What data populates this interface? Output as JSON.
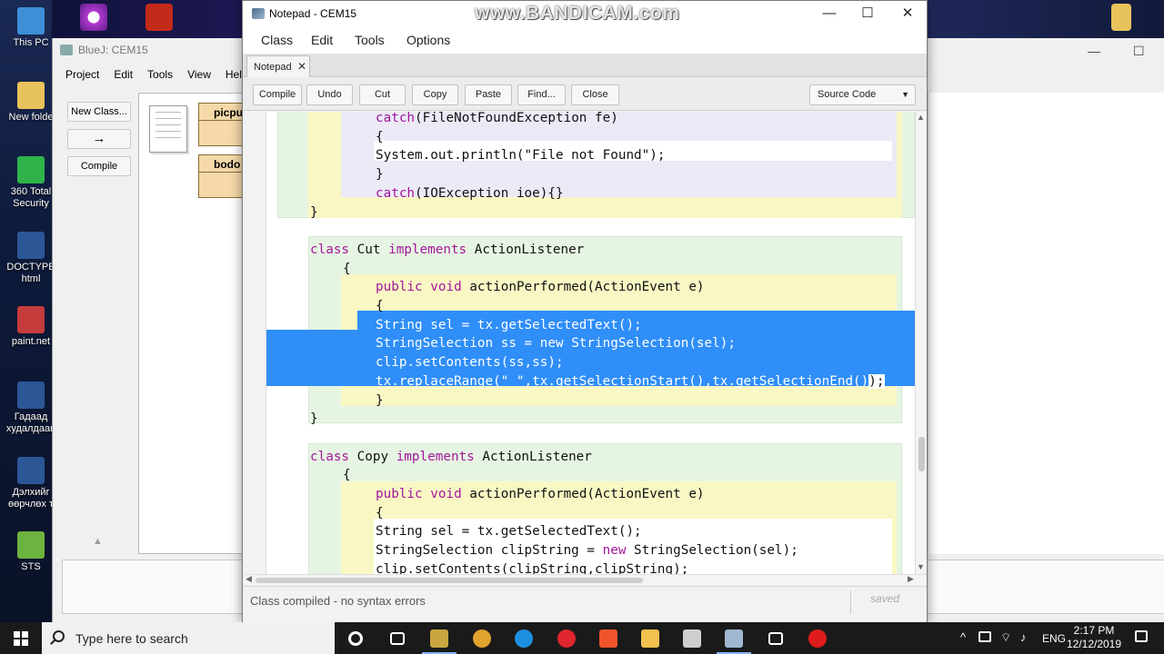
{
  "watermark": "www.BANDICAM.com",
  "desktop": {
    "icons": [
      {
        "label": "This PC",
        "icon": "computer-icon",
        "color": "#3d8fd8"
      },
      {
        "label": "New folde",
        "icon": "folder-icon",
        "color": "#e8c25a"
      },
      {
        "label": "360 Total Security",
        "icon": "shield-plus-icon",
        "color": "#2fb34a"
      },
      {
        "label": "DOCTYPE html",
        "icon": "word-doc-icon",
        "color": "#2b5797"
      },
      {
        "label": "paint.net",
        "icon": "paintnet-icon",
        "color": "#c43c3c"
      },
      {
        "label": "Гадаад худалдаан",
        "icon": "word-doc-icon",
        "color": "#2b5797"
      },
      {
        "label": "Дэлхийг өөрчлөх т",
        "icon": "word-doc-icon",
        "color": "#2b5797"
      },
      {
        "label": "STS",
        "icon": "sts-leaf-icon",
        "color": "#6db33f"
      }
    ]
  },
  "bluej": {
    "title": "BlueJ:  CEM15",
    "menu": [
      "Project",
      "Edit",
      "Tools",
      "View",
      "Help"
    ],
    "buttons": {
      "new_class": "New Class...",
      "arrow": "→",
      "compile": "Compile"
    },
    "classes": [
      {
        "name": "picpu"
      },
      {
        "name": "bodo"
      }
    ],
    "triangle": "▲"
  },
  "notepad": {
    "title": "Notepad - CEM15",
    "window_controls": {
      "minimize": "—",
      "maximize": "☐",
      "close": "✕"
    },
    "menu": [
      "Class",
      "Edit",
      "Tools",
      "Options"
    ],
    "tab": {
      "label": "Notepad",
      "close": "✕"
    },
    "toolbar": {
      "buttons": [
        "Compile",
        "Undo",
        "Cut",
        "Copy",
        "Paste",
        "Find...",
        "Close"
      ],
      "view_select": "Source Code",
      "view_caret": "▼"
    },
    "code_lines": [
      {
        "indent": 3,
        "parts": [
          [
            "kw",
            "catch"
          ],
          [
            "",
            "(FileNotFoundException fe)"
          ]
        ]
      },
      {
        "indent": 4,
        "parts": [
          [
            "",
            "{"
          ]
        ]
      },
      {
        "indent": 4,
        "parts": [
          [
            "",
            "System.out.println(\"File not Found\");"
          ]
        ]
      },
      {
        "indent": 3,
        "parts": [
          [
            "",
            "}"
          ]
        ]
      },
      {
        "indent": 3,
        "parts": [
          [
            "kw",
            "catch"
          ],
          [
            "",
            "(IOException ioe){}"
          ]
        ]
      },
      {
        "indent": 1,
        "parts": [
          [
            "",
            "}"
          ]
        ]
      },
      {
        "indent": 0,
        "parts": [
          [
            "",
            ""
          ]
        ]
      },
      {
        "indent": 1,
        "parts": [
          [
            "kw",
            "class"
          ],
          [
            "",
            " Cut "
          ],
          [
            "kw",
            "implements"
          ],
          [
            "",
            " ActionListener"
          ]
        ]
      },
      {
        "indent": 2,
        "parts": [
          [
            "",
            "{"
          ]
        ]
      },
      {
        "indent": 3,
        "parts": [
          [
            "kw",
            "public"
          ],
          [
            "",
            " "
          ],
          [
            "kw",
            "void"
          ],
          [
            "",
            " actionPerformed(ActionEvent e)"
          ]
        ]
      },
      {
        "indent": 4,
        "parts": [
          [
            "",
            "{"
          ]
        ]
      },
      {
        "indent": 4,
        "sel": true,
        "parts": [
          [
            "",
            "String sel = tx.getSelectedText();"
          ]
        ]
      },
      {
        "indent": 4,
        "sel": true,
        "parts": [
          [
            "",
            "StringSelection ss = "
          ],
          [
            "kw",
            "new"
          ],
          [
            "",
            " StringSelection(sel);"
          ]
        ]
      },
      {
        "indent": 4,
        "sel": true,
        "parts": [
          [
            "",
            "clip.setContents(ss,ss);"
          ]
        ]
      },
      {
        "indent": 4,
        "sel": true,
        "tail": ");",
        "parts": [
          [
            "",
            "tx.replaceRange(\" \",tx.getSelectionStart(),tx.getSelectionEnd()"
          ]
        ]
      },
      {
        "indent": 3,
        "parts": [
          [
            "",
            "}"
          ]
        ]
      },
      {
        "indent": 1,
        "parts": [
          [
            "",
            "}"
          ]
        ]
      },
      {
        "indent": 0,
        "parts": [
          [
            "",
            ""
          ]
        ]
      },
      {
        "indent": 1,
        "parts": [
          [
            "kw",
            "class"
          ],
          [
            "",
            " Copy "
          ],
          [
            "kw",
            "implements"
          ],
          [
            "",
            " ActionListener"
          ]
        ]
      },
      {
        "indent": 2,
        "parts": [
          [
            "",
            "{"
          ]
        ]
      },
      {
        "indent": 3,
        "parts": [
          [
            "kw",
            "public"
          ],
          [
            "",
            " "
          ],
          [
            "kw",
            "void"
          ],
          [
            "",
            " actionPerformed(ActionEvent e)"
          ]
        ]
      },
      {
        "indent": 4,
        "parts": [
          [
            "",
            "{"
          ]
        ]
      },
      {
        "indent": 4,
        "parts": [
          [
            "",
            "String sel = tx.getSelectedText();"
          ]
        ]
      },
      {
        "indent": 4,
        "parts": [
          [
            "",
            "StringSelection clipString = "
          ],
          [
            "kw",
            "new"
          ],
          [
            "",
            " StringSelection(sel);"
          ]
        ]
      },
      {
        "indent": 4,
        "parts": [
          [
            "",
            "clip.setContents(clipString,clipString);"
          ]
        ]
      }
    ],
    "status": {
      "message": "Class compiled - no syntax errors",
      "saved": "saved"
    },
    "colors": {
      "keyword": "#a3179b",
      "selection": "#2f8ef8",
      "scope_green": "#e6f5e3",
      "scope_yellow": "#f9f8c4",
      "scope_lavender": "#eceaf7"
    }
  },
  "taskbar": {
    "search_placeholder": "Type here to search",
    "apps": [
      {
        "icon": "cortana-circle-icon",
        "color": "#ffffff"
      },
      {
        "icon": "task-view-icon",
        "color": "#ffffff"
      },
      {
        "icon": "bluej-app-icon",
        "color": "#c9a640"
      },
      {
        "icon": "chrome-icon",
        "color": "#e0a32e"
      },
      {
        "icon": "edge-icon",
        "color": "#1e8fe0"
      },
      {
        "icon": "opera-icon",
        "color": "#e0262e"
      },
      {
        "icon": "brave-icon",
        "color": "#f0542d"
      },
      {
        "icon": "file-explorer-icon",
        "color": "#f2c14e"
      },
      {
        "icon": "calculator-icon",
        "color": "#cfcfcf"
      },
      {
        "icon": "bluej-notepad-icon",
        "color": "#9fb7cf"
      },
      {
        "icon": "settings-gear-icon",
        "color": "#ffffff"
      },
      {
        "icon": "bandicam-record-icon",
        "color": "#e01b1b"
      }
    ],
    "tray": {
      "chevron": "^",
      "language": "ENG",
      "time": "2:17 PM",
      "date": "12/12/2019"
    }
  }
}
